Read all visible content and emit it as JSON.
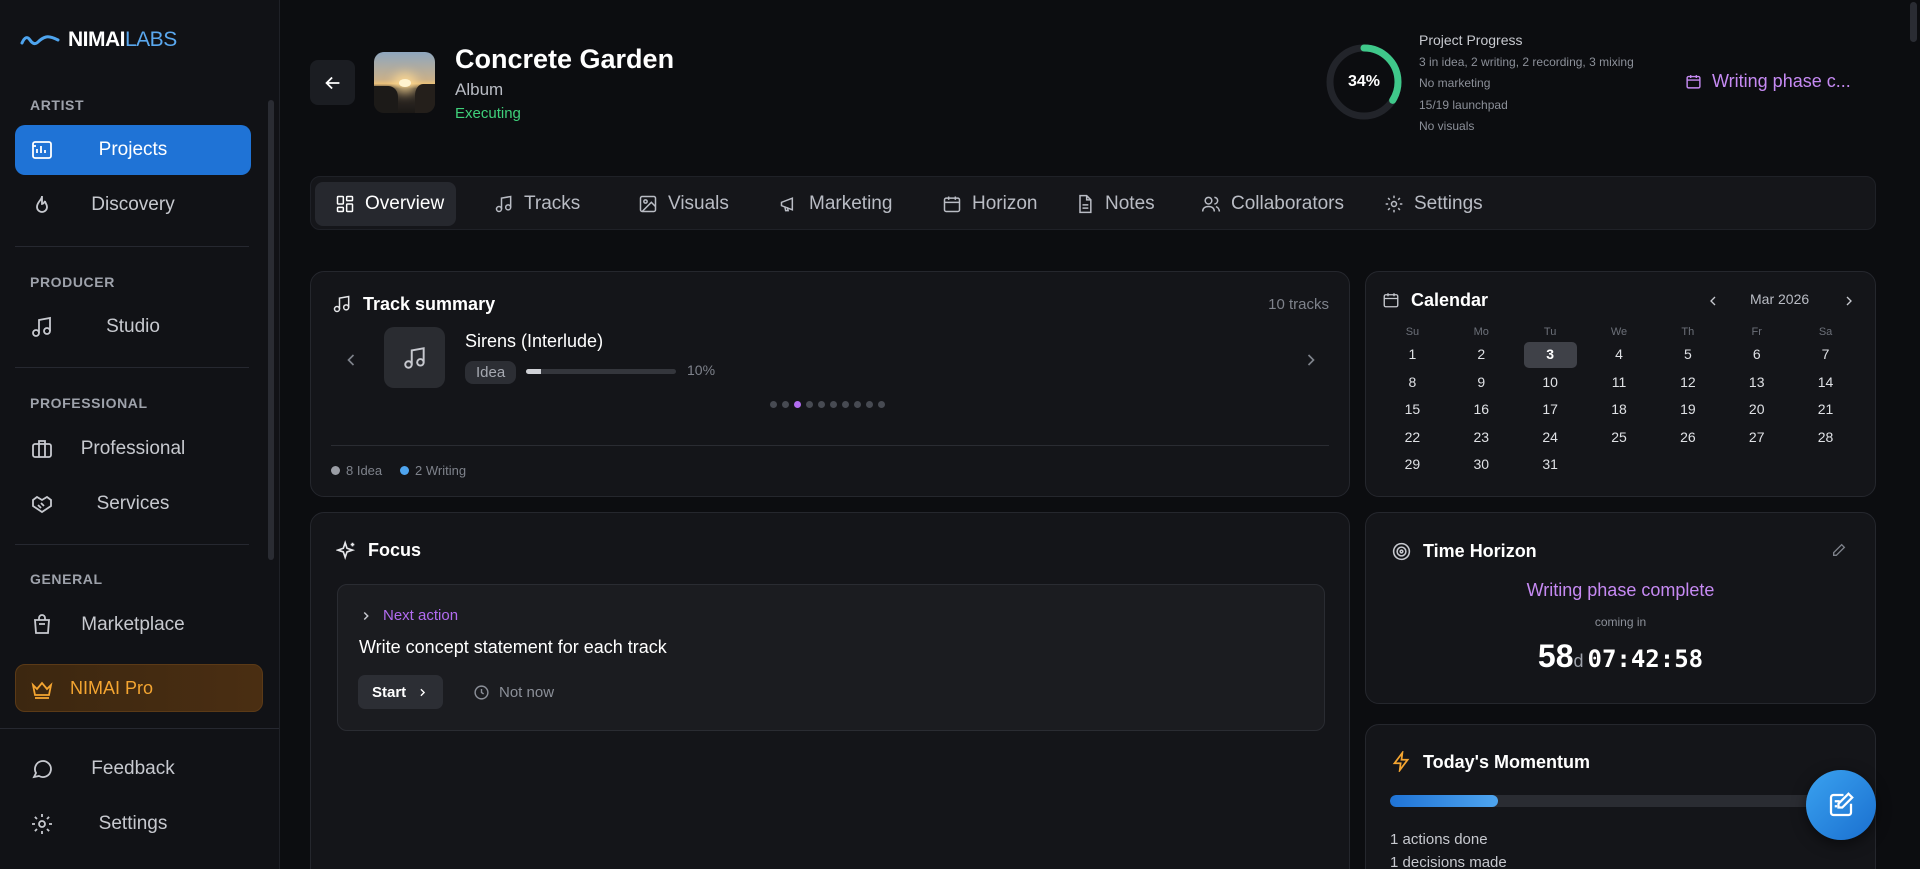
{
  "brand": {
    "name_main": "NIMAI",
    "name_accent": "LABS"
  },
  "sidebar": {
    "sections": {
      "artist": "ARTIST",
      "producer": "PRODUCER",
      "professional": "PROFESSIONAL",
      "general": "GENERAL"
    },
    "items": {
      "projects": "Projects",
      "discovery": "Discovery",
      "studio": "Studio",
      "professional": "Professional",
      "services": "Services",
      "marketplace": "Marketplace",
      "pro": "NIMAI Pro",
      "feedback": "Feedback",
      "settings": "Settings"
    },
    "active_item": "projects"
  },
  "project": {
    "title": "Concrete Garden",
    "type": "Album",
    "status": "Executing"
  },
  "progress": {
    "percent_label": "34%",
    "percent": 34,
    "title": "Project Progress",
    "lines": [
      "3 in idea, 2 writing, 2 recording, 3 mixing",
      "No marketing",
      "15/19 launchpad",
      "No visuals"
    ],
    "phase_link": "Writing phase c..."
  },
  "tabs": [
    "Overview",
    "Tracks",
    "Visuals",
    "Marketing",
    "Horizon",
    "Notes",
    "Collaborators",
    "Settings"
  ],
  "active_tab": "Overview",
  "track_summary": {
    "title": "Track summary",
    "count": "10 tracks",
    "current_track": {
      "name": "Sirens (Interlude)",
      "stage": "Idea",
      "progress_label": "10%",
      "progress": 0.1
    },
    "dots_total": 10,
    "dots_active_index": 2,
    "legend": [
      {
        "label": "8 Idea",
        "color": "#9a9da5"
      },
      {
        "label": "2 Writing",
        "color": "#4ea4ee"
      }
    ]
  },
  "calendar": {
    "title": "Calendar",
    "month": "Mar 2026",
    "weekdays": [
      "Su",
      "Mo",
      "Tu",
      "We",
      "Th",
      "Fr",
      "Sa"
    ],
    "days": [
      [
        "1",
        "2",
        "3",
        "4",
        "5",
        "6",
        "7"
      ],
      [
        "8",
        "9",
        "10",
        "11",
        "12",
        "13",
        "14"
      ],
      [
        "15",
        "16",
        "17",
        "18",
        "19",
        "20",
        "21"
      ],
      [
        "22",
        "23",
        "24",
        "25",
        "26",
        "27",
        "28"
      ],
      [
        "29",
        "30",
        "31",
        "",
        "",
        "",
        ""
      ]
    ],
    "today": "3"
  },
  "focus": {
    "title": "Focus",
    "next_action_label": "Next action",
    "next_action_text": "Write concept statement for each track",
    "start_label": "Start",
    "not_now_label": "Not now"
  },
  "time_horizon": {
    "title": "Time Horizon",
    "phase": "Writing phase complete",
    "coming_in": "coming in",
    "days": "58",
    "days_unit": "d",
    "clock": "07:42:58"
  },
  "momentum": {
    "title": "Today's Momentum",
    "progress": 0.25,
    "lines": [
      "1 actions done",
      "1 decisions made"
    ]
  },
  "colors": {
    "accent": "#1f73d6",
    "purple": "#b26cf0",
    "green": "#3fd07a",
    "pro": "#f4a531"
  }
}
